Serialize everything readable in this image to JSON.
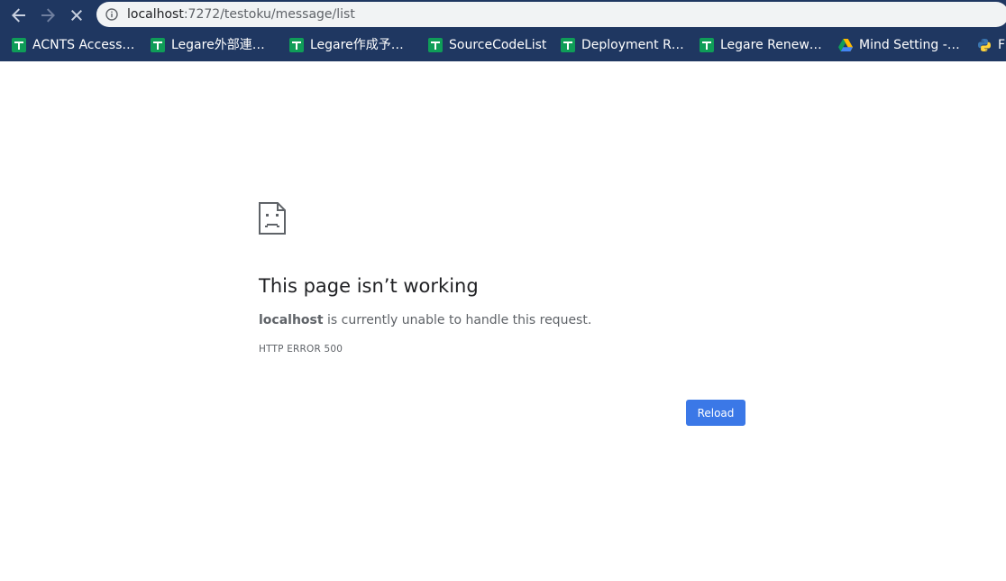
{
  "browser": {
    "url_host": "localhost",
    "url_rest": ":7272/testoku/message/list",
    "colors": {
      "chrome_bg": "#1f3761",
      "omnibox_bg": "#f1f3f4",
      "reload_button": "#3b78e7"
    },
    "icons": {
      "back": "arrow-left-icon",
      "forward": "arrow-right-icon",
      "stop": "close-icon",
      "site_info": "info-icon"
    }
  },
  "bookmarks": [
    {
      "label": "ACNTS Access…",
      "icon": "google-sheets-icon"
    },
    {
      "label": "Legare外部連…",
      "icon": "google-sheets-icon"
    },
    {
      "label": "Legare作成予…",
      "icon": "google-sheets-icon"
    },
    {
      "label": "SourceCodeList",
      "icon": "google-sheets-icon"
    },
    {
      "label": "Deployment R…",
      "icon": "google-sheets-icon"
    },
    {
      "label": "Legare Renew…",
      "icon": "google-sheets-icon"
    },
    {
      "label": "Mind Setting -…",
      "icon": "google-drive-icon"
    },
    {
      "label": "F",
      "icon": "python-icon"
    }
  ],
  "error": {
    "icon": "sad-page-icon",
    "title": "This page isn’t working",
    "host": "localhost",
    "description": " is currently unable to handle this request.",
    "code": "HTTP ERROR 500",
    "reload_label": "Reload"
  }
}
